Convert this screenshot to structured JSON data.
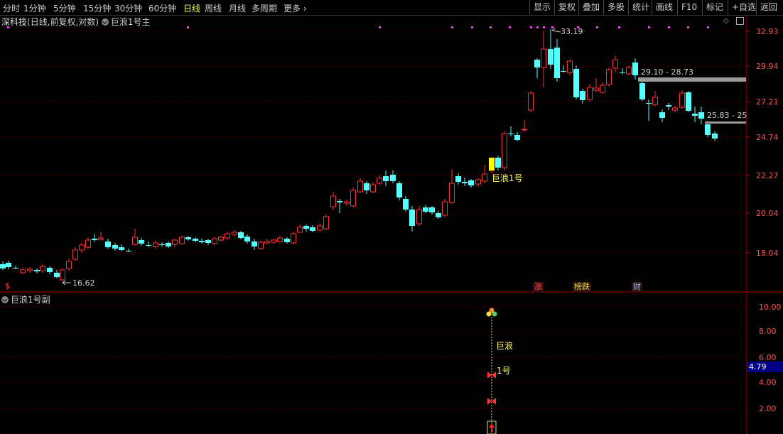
{
  "toolbar": {
    "periods": [
      "分时",
      "1分钟",
      "5分钟",
      "15分钟",
      "30分钟",
      "60分钟",
      "日线",
      "周线",
      "月线",
      "多周期",
      "更多"
    ],
    "active": "日线",
    "right_buttons": [
      "显示",
      "复权",
      "叠加",
      "多股",
      "统计",
      "画线",
      "F10",
      "标记",
      "+自选",
      "返回"
    ]
  },
  "main_panel": {
    "stock": "深科技",
    "mode": "(日线,前复权,对数)",
    "indicator": "巨浪1号主",
    "y_axis_ticks": [
      "32.93",
      "29.94",
      "27.21",
      "24.74",
      "22.27",
      "20.04",
      "18.04"
    ],
    "annotations": {
      "high": "33.19",
      "low": "16.62",
      "band1": "29.10 - 28.73",
      "band2": "25.83 - 25",
      "signal": "巨浪1号"
    },
    "news_badges": [
      {
        "text": "涨",
        "color": "#ff4444"
      },
      {
        "text": "榜跌",
        "color": "#dddd44"
      },
      {
        "text": "财",
        "color": "#88bbff"
      }
    ],
    "corner_icon": "$"
  },
  "sub_panel": {
    "indicator": "巨浪1号副",
    "y_axis_ticks": [
      "10.00",
      "8.00",
      "6.00",
      "4.00",
      "2.00"
    ],
    "current_value": "4.79",
    "labels": {
      "wave": "巨浪",
      "num": "1号"
    }
  },
  "colors": {
    "up": "#ff3232",
    "down": "#54ffff",
    "grid": "#6a0000",
    "axis_label": "#ff5555",
    "highlight": "#ffff00"
  }
}
